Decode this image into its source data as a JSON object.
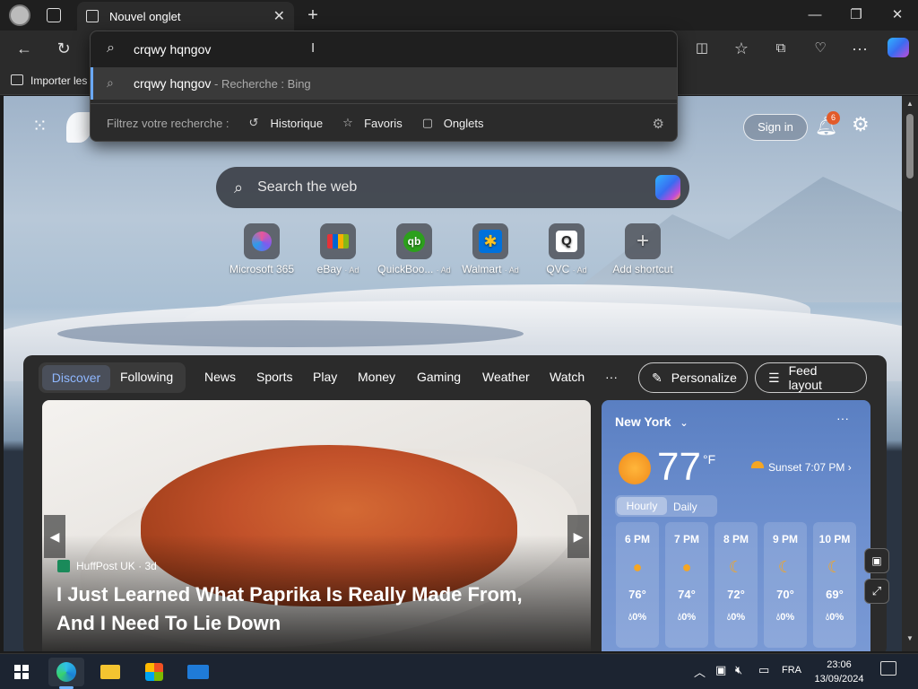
{
  "browser": {
    "tab_title": "Nouvel onglet",
    "address_value": "crqwy hqngov",
    "favbar_item": "Importer les"
  },
  "omnibox": {
    "suggestion_query": "crqwy hqngov",
    "suggestion_suffix": " - Recherche : Bing",
    "filter_label": "Filtrez votre recherche :",
    "filters": [
      "Historique",
      "Favoris",
      "Onglets"
    ]
  },
  "newtab": {
    "sign_in": "Sign in",
    "notif_count": "6",
    "search_placeholder": "Search the web",
    "shortcuts": [
      {
        "label": "Microsoft 365",
        "ad": ""
      },
      {
        "label": "eBay",
        "ad": "· Ad"
      },
      {
        "label": "QuickBoo...",
        "ad": "· Ad"
      },
      {
        "label": "Walmart",
        "ad": "· Ad"
      },
      {
        "label": "QVC",
        "ad": "· Ad"
      },
      {
        "label": "Add shortcut",
        "ad": ""
      }
    ]
  },
  "feed": {
    "tabs": [
      "Discover",
      "Following",
      "News",
      "Sports",
      "Play",
      "Money",
      "Gaming",
      "Weather",
      "Watch",
      "···"
    ],
    "personalize": "Personalize",
    "feed_layout": "Feed layout",
    "hero": {
      "source": "HuffPost UK · 3d",
      "headline_line1": "I Just Learned What Paprika Is Really Made From,",
      "headline_line2": "And I Need To Lie Down"
    }
  },
  "weather": {
    "location": "New York",
    "temp": "77",
    "unit": "°F",
    "sunset": "Sunset 7:07 PM",
    "tabs": [
      "Hourly",
      "Daily"
    ],
    "hours": [
      {
        "time": "6 PM",
        "icon": "sun",
        "temp": "76°",
        "precip": "0%"
      },
      {
        "time": "7 PM",
        "icon": "sun",
        "temp": "74°",
        "precip": "0%"
      },
      {
        "time": "8 PM",
        "icon": "moon",
        "temp": "72°",
        "precip": "0%"
      },
      {
        "time": "9 PM",
        "icon": "moon",
        "temp": "70°",
        "precip": "0%"
      },
      {
        "time": "10 PM",
        "icon": "moon",
        "temp": "69°",
        "precip": "0%"
      }
    ]
  },
  "taskbar": {
    "lang": "FRA",
    "time": "23:06",
    "date": "13/09/2024"
  }
}
